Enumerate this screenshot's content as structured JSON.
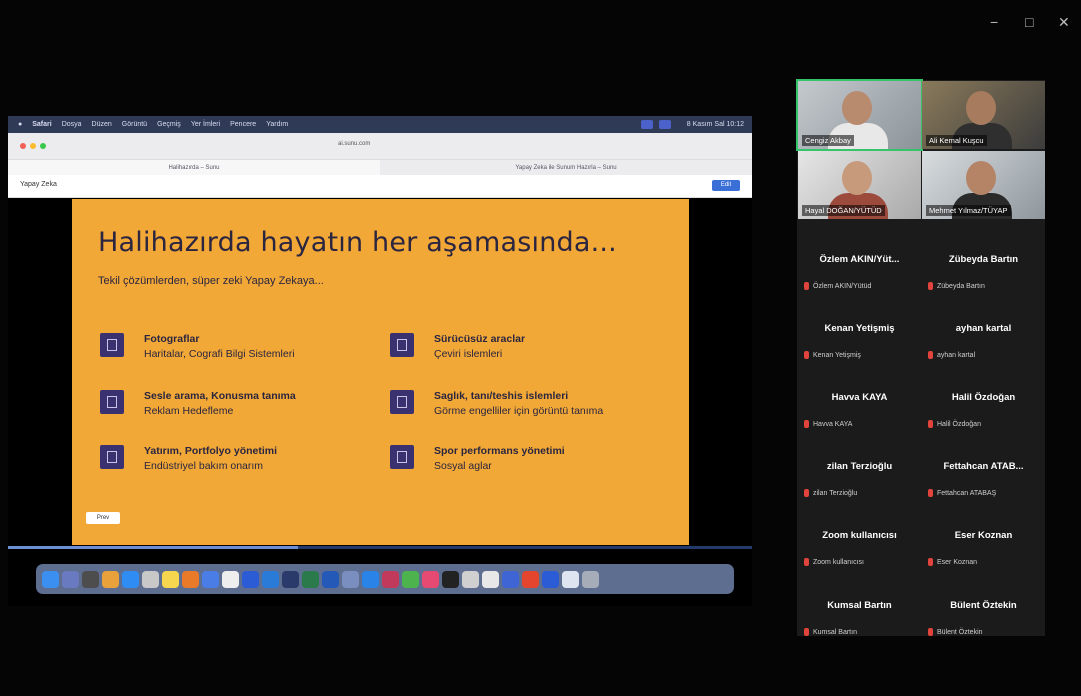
{
  "window_controls": {
    "minimize": "−",
    "maximize": "□",
    "close": "✕"
  },
  "shared_screen": {
    "menubar": [
      "Safari",
      "Dosya",
      "Düzen",
      "Görüntü",
      "Geçmiş",
      "Yer İmleri",
      "Pencere",
      "Yardım"
    ],
    "menubar_clock": "8 Kasım Sal 10:12",
    "url": "ai.sunu.com",
    "tabs": [
      "Halihazırda – Sunu",
      "Yapay Zeka ile Sunum Hazırla – Sunu"
    ],
    "doc_title": "Yapay Zeka",
    "edit_label": "Edit",
    "slide": {
      "title": "Halihazırda hayatın her aşamasında...",
      "subtitle": "Tekil çözümlerden, süper zeki Yapay Zekaya...",
      "items": [
        {
          "title": "Fotograflar",
          "sub": "Haritalar, Cografi Bilgi Sistemleri"
        },
        {
          "title": "Sürücüsüz araclar",
          "sub": "Çeviri islemleri"
        },
        {
          "title": "Sesle arama, Konusma tanıma",
          "sub": "Reklam Hedefleme"
        },
        {
          "title": "Saglık, tanı/teshis islemleri",
          "sub": "Görme engelliler için görüntü tanıma"
        },
        {
          "title": "Yatırım, Portfolyo yönetimi",
          "sub": "Endüstriyel bakım onarım"
        },
        {
          "title": "Spor performans yönetimi",
          "sub": "Sosyal aglar"
        }
      ],
      "prev_label": "Prev"
    },
    "progress": 0.39
  },
  "gallery": {
    "videos": [
      {
        "name": "Cengiz Akbay"
      },
      {
        "name": "Ali Kemal Kuşcu"
      },
      {
        "name": "Hayal DOĞAN/YÜTÜD"
      },
      {
        "name": "Mehmet Yılmaz/TÜYAP"
      }
    ],
    "tiles": [
      {
        "name": "Özlem AKIN/Yüt...",
        "small": "Özlem AKIN/Yütüd"
      },
      {
        "name": "Zübeyda Bartın",
        "small": "Zübeyda Bartın"
      },
      {
        "name": "Kenan Yetişmiş",
        "small": "Kenan Yetişmiş"
      },
      {
        "name": "ayhan kartal",
        "small": "ayhan kartal"
      },
      {
        "name": "Havva KAYA",
        "small": "Havva KAYA"
      },
      {
        "name": "Halil Özdoğan",
        "small": "Halil Özdoğan"
      },
      {
        "name": "zilan Terzioğlu",
        "small": "zilan Terzioğlu"
      },
      {
        "name": "Fettahcan ATAB...",
        "small": "Fettahcan ATABAŞ"
      },
      {
        "name": "Zoom kullanıcısı",
        "small": "Zoom kullanıcısı"
      },
      {
        "name": "Eser Koznan",
        "small": "Eser Koznan"
      },
      {
        "name": "Kumsal Bartın",
        "small": "Kumsal Bartın"
      },
      {
        "name": "Bülent Öztekin",
        "small": "Bülent Öztekin"
      }
    ],
    "mic_color": "#e0443c",
    "active_speaker_color": "#36c46a"
  }
}
